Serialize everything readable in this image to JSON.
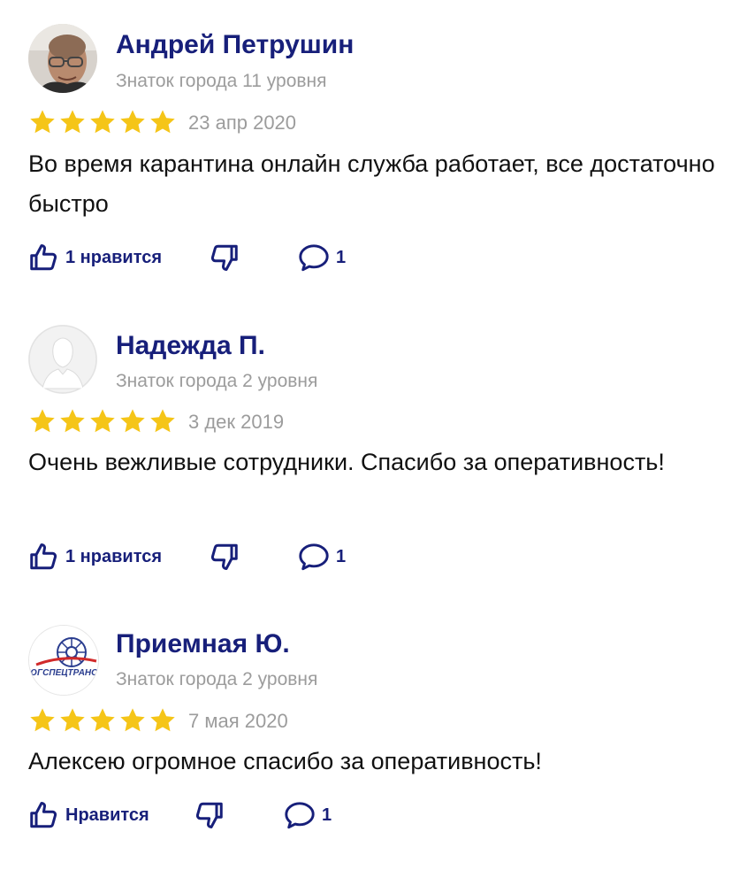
{
  "colors": {
    "accent": "#171f7a",
    "star": "#f5c518",
    "muted": "#9c9c9c"
  },
  "reviews": [
    {
      "author": "Андрей Петрушин",
      "level": "Знаток города 11 уровня",
      "rating": 5,
      "date": "23 апр 2020",
      "text": "Во время карантина онлайн служба работает, все достаточно быстро",
      "like_label": "1 нравится",
      "comments": "1",
      "avatar_icon": "user-photo-avatar"
    },
    {
      "author": "Надежда П.",
      "level": "Знаток города 2 уровня",
      "rating": 5,
      "date": "3 дек 2019",
      "text": "Очень вежливые сотрудники. Спасибо за оперативность!",
      "like_label": "1 нравится",
      "comments": "1",
      "avatar_icon": "default-user-avatar"
    },
    {
      "author": "Приемная Ю.",
      "level": "Знаток города 2 уровня",
      "rating": 5,
      "date": "7 мая 2020",
      "text": "Алексею огромное спасибо за оперативность!",
      "like_label": "Нравится",
      "comments": "1",
      "avatar_icon": "company-logo-avatar",
      "avatar_logo_text": "ЮГСПЕЦТРАНС"
    }
  ]
}
